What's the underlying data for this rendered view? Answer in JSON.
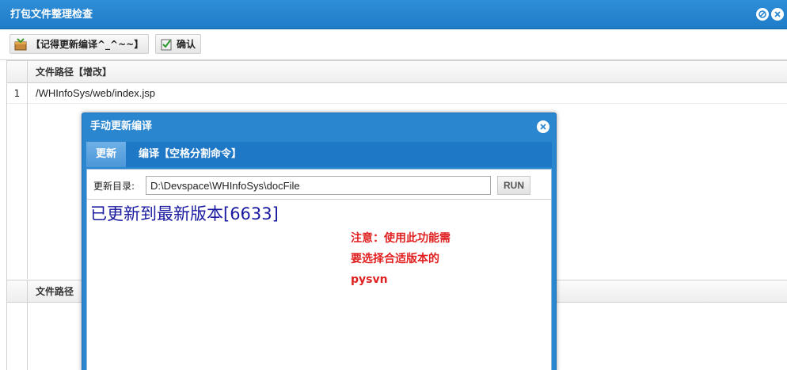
{
  "window": {
    "title": "打包文件整理检查",
    "icons": [
      "minimize-icon",
      "close-icon"
    ]
  },
  "toolbar": {
    "remember_label": "【记得更新编译^_^~~】",
    "confirm_label": "确认"
  },
  "grid1": {
    "header": "文件路径【增改】",
    "rows": [
      {
        "num": "1",
        "path": "/WHInfoSys/web/index.jsp"
      }
    ]
  },
  "grid2": {
    "header": "文件路径"
  },
  "modal": {
    "title": "手动更新编译",
    "tabs": [
      {
        "label": "更新",
        "active": true
      },
      {
        "label": "编译【空格分割命令】",
        "active": false
      }
    ],
    "dir_label": "更新目录:",
    "dir_value": "D:\\Devspace\\WHInfoSys\\docFile",
    "run_label": "RUN",
    "output": "已更新到最新版本[6633]",
    "note_lines": [
      "注意：使用此功能需",
      "要选择合适版本的",
      "pysvn"
    ]
  },
  "colors": {
    "title_bar": "#2a86cf",
    "note_text": "#e02020",
    "output_text": "#1a1aa0"
  }
}
